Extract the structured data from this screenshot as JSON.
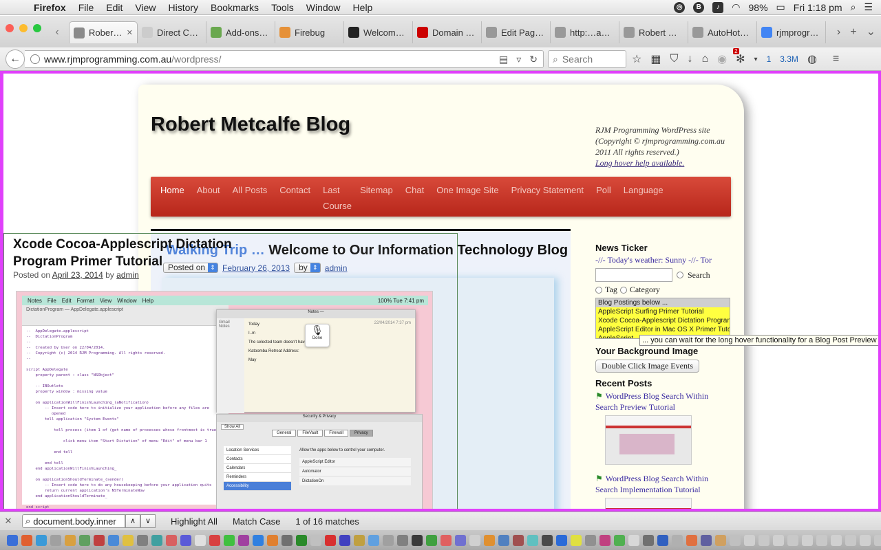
{
  "menubar": {
    "app": "Firefox",
    "items": [
      "File",
      "Edit",
      "View",
      "History",
      "Bookmarks",
      "Tools",
      "Window",
      "Help"
    ],
    "battery": "98%",
    "clock": "Fri 1:18 pm"
  },
  "tabs": [
    {
      "label": "Rober…",
      "active": true,
      "color": "#8a8a8a",
      "icon": "page-icon"
    },
    {
      "label": "Direct Cash A…",
      "active": false,
      "color": "#cccccc",
      "icon": "page-icon"
    },
    {
      "label": "Add-ons …",
      "active": false,
      "color": "#6aa84f",
      "icon": "puzzle-icon"
    },
    {
      "label": "Firebug",
      "active": false,
      "color": "#e69138",
      "icon": "bug-icon"
    },
    {
      "label": "Welcome…",
      "active": false,
      "color": "#222222",
      "icon": "page-icon"
    },
    {
      "label": "Domain …",
      "active": false,
      "color": "#cc0000",
      "icon": "z-icon"
    },
    {
      "label": "Edit Page…",
      "active": false,
      "color": "#999999",
      "icon": "page-icon"
    },
    {
      "label": "http:…ax.js",
      "active": false,
      "color": "#999999",
      "icon": "page-icon"
    },
    {
      "label": "Robert M…",
      "active": false,
      "color": "#999999",
      "icon": "page-icon"
    },
    {
      "label": "AutoHotK…",
      "active": false,
      "color": "#999999",
      "icon": "page-icon"
    },
    {
      "label": "rjmprogra…",
      "active": false,
      "color": "#4285f4",
      "icon": "google-icon"
    }
  ],
  "navbar": {
    "url_host": "www.rjmprogramming.com.au",
    "url_path": "/wordpress/",
    "search_placeholder": "Search",
    "badge": "2",
    "counter_a": "1",
    "counter_b": "3.3M"
  },
  "blog": {
    "title": "Robert Metcalfe Blog",
    "site_info": "RJM Programming WordPress site (Copyright © rjmprogramming.com.au 2011 All rights reserved.)",
    "hover_help": "Long hover help available.",
    "nav": [
      "Home",
      "About",
      "All Posts",
      "Contact",
      "Last Course",
      "Sitemap",
      "Chat",
      "One Image Site",
      "Privacy Statement",
      "Poll",
      "Language"
    ],
    "page_heading_link": "Walking Trip …",
    "page_heading_text": "Welcome to Our Information Technology Blog",
    "posted_on_select": "Posted on",
    "posted_date": "February 26, 2013",
    "by_select": "by",
    "author": "admin"
  },
  "post": {
    "title": "Xcode Cocoa-Applescript Dictation Program Primer Tutorial",
    "posted_on_label": "Posted on",
    "date": "April 23, 2014",
    "by_label": "by",
    "author": "admin",
    "screenshot": {
      "menu": [
        "Notes",
        "File",
        "Edit",
        "Format",
        "View",
        "Window",
        "Help"
      ],
      "menu_right": "100%  Tue 7:41 pm",
      "editor_tab": "DictationProgram — AppDelegate.applescript",
      "code": "--  AppDelegate.applescript\n--  DictationProgram\n--\n--  Created by User on 22/04/2014.\n--  Copyright (c) 2014 RJM Programming. All rights reserved.\n--\n\nscript AppDelegate\n    property parent : class \"NSObject\"\n\n    -- IBOutlets\n    property window : missing value\n\n    on applicationWillFinishLaunching_(aNotification)\n        -- Insert code here to initialize your application before any files are\n           opened\n        tell application \"System Events\"\n\n            tell process (item 1 of (get name of processes whose frontmost is true))\n\n                click menu item \"Start Dictation\" of menu \"Edit\" of menu bar 1\n\n            end tell\n\n        end tell\n    end applicationWillFinishLaunching_\n\n    on applicationShouldTerminate_(sender)\n        -- Insert code here to do any housekeeping before your application quits\n        return current application's NSTerminateNow\n    end applicationShouldTerminate_\n\nend script",
      "notes_title": "Notes —",
      "notes_side": [
        "Gmail",
        "Notes"
      ],
      "notes_date": "22/04/2014 7:37 pm",
      "notes_items": [
        "Today",
        "I..m",
        "The selected team doesn't have an iOS...",
        "Katoomba Retreat Address:",
        "May"
      ],
      "mic_label": "Done",
      "sec_title": "Security & Privacy",
      "sec_tabs": [
        "General",
        "FileVault",
        "Firewall",
        "Privacy"
      ],
      "sec_nav": [
        "Location Services",
        "Contacts",
        "Calendars",
        "Reminders",
        "Accessibility"
      ],
      "sec_allow": "Allow the apps below to control your computer.",
      "sec_apps": [
        "AppleScript Editor",
        "Automator",
        "DictationOn"
      ],
      "show_all": "Show All"
    }
  },
  "sidebar": {
    "ticker_heading": "News Ticker",
    "ticker_text": "-//- Today's weather: Sunny -//- Tor",
    "search_label": "Search",
    "tag_label": "Tag",
    "category_label": "Category",
    "list_head": "Blog Postings below ...",
    "list_items": [
      "AppleScript Surfing Primer Tutorial",
      "Xcode Cocoa-Applescript Dictation Program",
      "AppleScript Editor in Mac OS X Primer Tuto",
      "AppleScript"
    ],
    "tooltip": "... you can wait for the long hover functionality for a Blog Post Preview",
    "bg_heading": "Your Background Image",
    "bg_button": "Double Click Image Events",
    "recent_heading": "Recent Posts",
    "recent": [
      "WordPress Blog Search Within Search Preview Tutorial",
      "WordPress Blog Search Within Search Implementation Tutorial"
    ]
  },
  "findbar": {
    "query": "document.body.inner",
    "highlight_all": "Highlight All",
    "match_case": "Match Case",
    "status": "1 of 16 matches"
  },
  "dock_colors": [
    "#3a6fd8",
    "#e06030",
    "#3a9ad8",
    "#a0a0a0",
    "#d8a040",
    "#60a060",
    "#c04040",
    "#4a8ad8",
    "#e0c040",
    "#808080",
    "#40a0a0",
    "#d86060",
    "#5a5ad8",
    "#e0e0e0",
    "#d84040",
    "#40c040",
    "#a040a0",
    "#3080e0",
    "#e08030",
    "#707070",
    "#2a8a2a",
    "#c0c0c0",
    "#d83030",
    "#4040c0",
    "#c0a040",
    "#60a0e0",
    "#a0a0a0",
    "#808080",
    "#3a3a3a",
    "#40a040",
    "#e06060",
    "#7070d0",
    "#d0d0d0",
    "#e09030",
    "#5080c0",
    "#a05050",
    "#60c0c0",
    "#4a4a4a",
    "#2a6ad8",
    "#e0e040",
    "#909090",
    "#c04080",
    "#50b050",
    "#d8d8d8",
    "#707070",
    "#3060c0",
    "#b0b0b0",
    "#e07040",
    "#6060a0",
    "#d0a060",
    "#c0c0c0",
    "#d0d0d0",
    "#c8c8c8",
    "#d0d0d0",
    "#c8c8c8",
    "#d0d0d0",
    "#c8c8c8",
    "#d0d0d0",
    "#c8c8c8",
    "#d0d0d0",
    "#c8c8c8",
    "#d0d0d0",
    "#c8c8c8",
    "#909090"
  ]
}
